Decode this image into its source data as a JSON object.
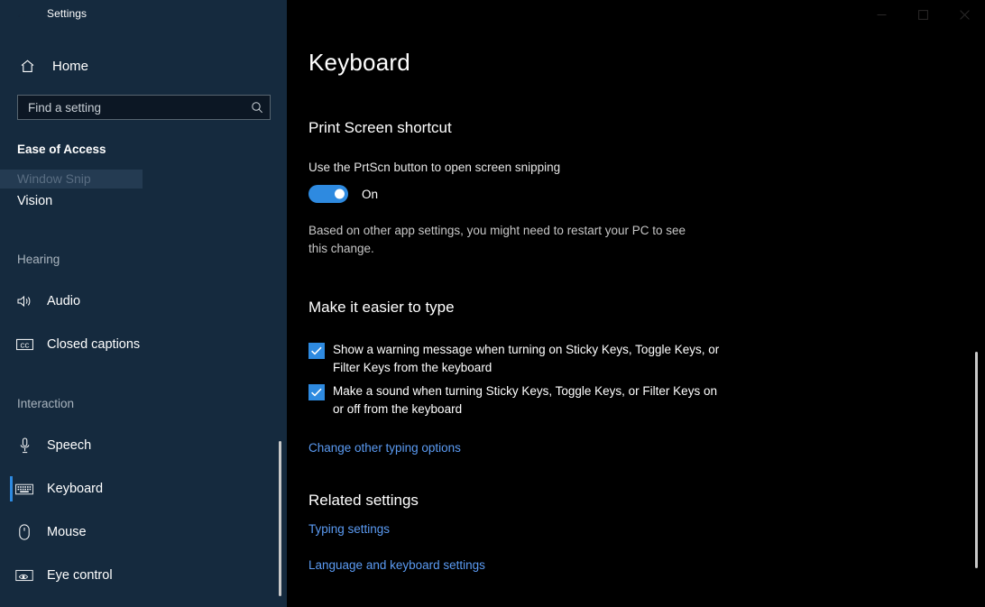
{
  "window": {
    "title": "Settings",
    "back_icon": "back-arrow-icon",
    "controls": [
      {
        "name": "minimize",
        "glyph": "minimize-icon"
      },
      {
        "name": "maximize",
        "glyph": "maximize-icon"
      },
      {
        "name": "close",
        "glyph": "close-icon"
      }
    ]
  },
  "sidebar": {
    "home_label": "Home",
    "home_icon": "home-icon",
    "search": {
      "placeholder": "Find a setting",
      "value": "",
      "icon": "search-icon"
    },
    "section_header": "Ease of Access",
    "ghost_item": "Window Snip",
    "plain_item": "Vision",
    "groups": [
      {
        "label": "Hearing",
        "items": [
          {
            "label": "Audio",
            "icon": "speaker-icon",
            "selected": false
          },
          {
            "label": "Closed captions",
            "icon": "closed-captions-icon",
            "selected": false
          }
        ]
      },
      {
        "label": "Interaction",
        "items": [
          {
            "label": "Speech",
            "icon": "microphone-icon",
            "selected": false
          },
          {
            "label": "Keyboard",
            "icon": "keyboard-icon",
            "selected": true
          },
          {
            "label": "Mouse",
            "icon": "mouse-icon",
            "selected": false
          },
          {
            "label": "Eye control",
            "icon": "eye-control-icon",
            "selected": false
          }
        ]
      }
    ]
  },
  "content": {
    "page_title": "Keyboard",
    "print_screen": {
      "heading": "Print Screen shortcut",
      "description": "Use the PrtScn button to open screen snipping",
      "toggle_state": "On",
      "toggle_on": true,
      "note": "Based on other app settings, you might need to restart your PC to see this change."
    },
    "easier_to_type": {
      "heading": "Make it easier to type",
      "checkboxes": [
        {
          "label": "Show a warning message when turning on Sticky Keys, Toggle Keys, or Filter Keys from the keyboard",
          "checked": true
        },
        {
          "label": "Make a sound when turning Sticky Keys, Toggle Keys, or Filter Keys on or off from the keyboard",
          "checked": true
        }
      ],
      "link": "Change other typing options"
    },
    "related_settings": {
      "heading": "Related settings",
      "links": [
        "Typing settings",
        "Language and keyboard settings"
      ]
    }
  },
  "colors": {
    "sidebar_bg": "#152a3e",
    "content_bg": "#000000",
    "accent": "#2e8ae0",
    "link": "#5b9bf3"
  }
}
